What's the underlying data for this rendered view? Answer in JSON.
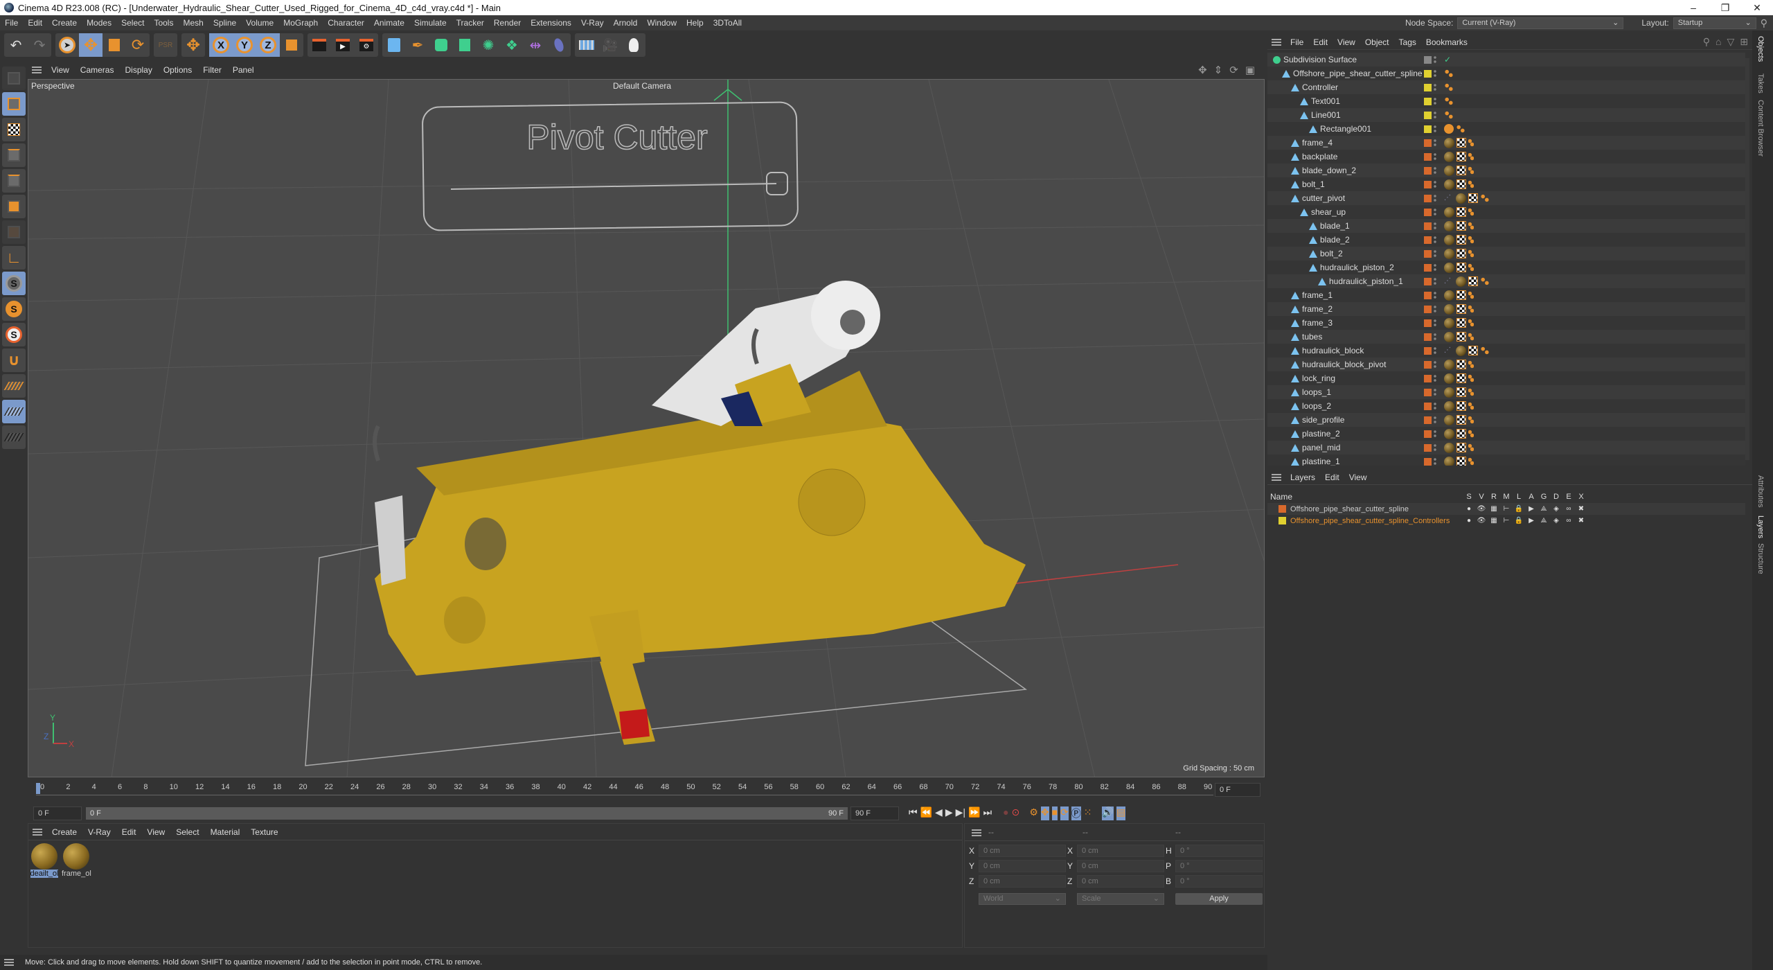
{
  "window": {
    "title": "Cinema 4D R23.008 (RC) - [Underwater_Hydraulic_Shear_Cutter_Used_Rigged_for_Cinema_4D_c4d_vray.c4d *] - Main",
    "controls": [
      "–",
      "❐",
      "✕"
    ]
  },
  "menubar": {
    "items": [
      "File",
      "Edit",
      "Create",
      "Modes",
      "Select",
      "Tools",
      "Mesh",
      "Spline",
      "Volume",
      "MoGraph",
      "Character",
      "Animate",
      "Simulate",
      "Tracker",
      "Render",
      "Extensions",
      "V-Ray",
      "Arnold",
      "Window",
      "Help",
      "3DToAll"
    ],
    "node_space_label": "Node Space:",
    "node_space_value": "Current (V-Ray)",
    "layout_label": "Layout:",
    "layout_value": "Startup"
  },
  "toolbar": {
    "axis_x": "X",
    "axis_y": "Y",
    "axis_z": "Z"
  },
  "viewport": {
    "menu": [
      "View",
      "Cameras",
      "Display",
      "Options",
      "Filter",
      "Panel"
    ],
    "view_name": "Perspective",
    "camera": "Default Camera",
    "grid_spacing": "Grid Spacing : 50 cm",
    "controller_text": "Pivot Cutter",
    "axis_labels": {
      "x": "X",
      "y": "Y",
      "z": "Z"
    }
  },
  "timeline": {
    "ticks": [
      "0",
      "2",
      "4",
      "6",
      "8",
      "10",
      "12",
      "14",
      "16",
      "18",
      "20",
      "22",
      "24",
      "26",
      "28",
      "30",
      "32",
      "34",
      "36",
      "38",
      "40",
      "42",
      "44",
      "46",
      "48",
      "50",
      "52",
      "54",
      "56",
      "58",
      "60",
      "62",
      "64",
      "66",
      "68",
      "70",
      "72",
      "74",
      "76",
      "78",
      "80",
      "82",
      "84",
      "86",
      "88",
      "90"
    ],
    "current_frame_field": "0 F",
    "start_field": "0 F",
    "range_start": "0 F",
    "range_end": "90 F",
    "end_field": "90 F",
    "current_right": "0 F"
  },
  "material_manager": {
    "menu": [
      "Create",
      "V-Ray",
      "Edit",
      "View",
      "Select",
      "Material",
      "Texture"
    ],
    "materials": [
      {
        "name": "deailt_ol",
        "selected": true
      },
      {
        "name": "frame_ol",
        "selected": false
      }
    ]
  },
  "coordinates": {
    "headers": [
      "--",
      "--",
      "--"
    ],
    "rows": [
      {
        "l1": "X",
        "v1": "0 cm",
        "l2": "X",
        "v2": "0 cm",
        "l3": "H",
        "v3": "0 °"
      },
      {
        "l1": "Y",
        "v1": "0 cm",
        "l2": "Y",
        "v2": "0 cm",
        "l3": "P",
        "v3": "0 °"
      },
      {
        "l1": "Z",
        "v1": "0 cm",
        "l2": "Z",
        "v2": "0 cm",
        "l3": "B",
        "v3": "0 °"
      }
    ],
    "mode": "World",
    "transform": "Scale",
    "apply": "Apply"
  },
  "status": "Move: Click and drag to move elements. Hold down SHIFT to quantize movement / add to the selection in point mode, CTRL to remove.",
  "object_manager": {
    "menu": [
      "File",
      "Edit",
      "View",
      "Object",
      "Tags",
      "Bookmarks"
    ],
    "objects": [
      {
        "name": "Subdivision Surface",
        "depth": 0,
        "color": "#888888",
        "tags": "check",
        "root": true
      },
      {
        "name": "Offshore_pipe_shear_cutter_spline",
        "depth": 1,
        "color": "#e0d030",
        "tags": "spline"
      },
      {
        "name": "Controller",
        "depth": 2,
        "color": "#e0d030",
        "tags": "spline"
      },
      {
        "name": "Text001",
        "depth": 3,
        "color": "#e0d030",
        "tags": "spline"
      },
      {
        "name": "Line001",
        "depth": 3,
        "color": "#e0d030",
        "tags": "spline"
      },
      {
        "name": "Rectangle001",
        "depth": 4,
        "color": "#e0d030",
        "tags": "nospline"
      },
      {
        "name": "frame_4",
        "depth": 2,
        "color": "#d8692c",
        "tags": "mat"
      },
      {
        "name": "backplate",
        "depth": 2,
        "color": "#d8692c",
        "tags": "mat"
      },
      {
        "name": "blade_down_2",
        "depth": 2,
        "color": "#d8692c",
        "tags": "mat"
      },
      {
        "name": "bolt_1",
        "depth": 2,
        "color": "#d8692c",
        "tags": "mat"
      },
      {
        "name": "cutter_pivot",
        "depth": 2,
        "color": "#d8692c",
        "tags": "ik"
      },
      {
        "name": "shear_up",
        "depth": 3,
        "color": "#d8692c",
        "tags": "mat"
      },
      {
        "name": "blade_1",
        "depth": 4,
        "color": "#d8692c",
        "tags": "mat"
      },
      {
        "name": "blade_2",
        "depth": 4,
        "color": "#d8692c",
        "tags": "mat"
      },
      {
        "name": "bolt_2",
        "depth": 4,
        "color": "#d8692c",
        "tags": "mat"
      },
      {
        "name": "hudraulick_piston_2",
        "depth": 4,
        "color": "#d8692c",
        "tags": "mat"
      },
      {
        "name": "hudraulick_piston_1",
        "depth": 5,
        "color": "#d8692c",
        "tags": "ik"
      },
      {
        "name": "frame_1",
        "depth": 2,
        "color": "#d8692c",
        "tags": "mat"
      },
      {
        "name": "frame_2",
        "depth": 2,
        "color": "#d8692c",
        "tags": "mat"
      },
      {
        "name": "frame_3",
        "depth": 2,
        "color": "#d8692c",
        "tags": "mat"
      },
      {
        "name": "tubes",
        "depth": 2,
        "color": "#d8692c",
        "tags": "mat"
      },
      {
        "name": "hudraulick_block",
        "depth": 2,
        "color": "#d8692c",
        "tags": "ik"
      },
      {
        "name": "hudraulick_block_pivot",
        "depth": 2,
        "color": "#d8692c",
        "tags": "mat"
      },
      {
        "name": "lock_ring",
        "depth": 2,
        "color": "#d8692c",
        "tags": "mat"
      },
      {
        "name": "loops_1",
        "depth": 2,
        "color": "#d8692c",
        "tags": "mat"
      },
      {
        "name": "loops_2",
        "depth": 2,
        "color": "#d8692c",
        "tags": "mat"
      },
      {
        "name": "side_profile",
        "depth": 2,
        "color": "#d8692c",
        "tags": "mat"
      },
      {
        "name": "plastine_2",
        "depth": 2,
        "color": "#d8692c",
        "tags": "mat"
      },
      {
        "name": "panel_mid",
        "depth": 2,
        "color": "#d8692c",
        "tags": "mat"
      },
      {
        "name": "plastine_1",
        "depth": 2,
        "color": "#d8692c",
        "tags": "mat"
      }
    ]
  },
  "layer_manager": {
    "menu": [
      "Layers",
      "Edit",
      "View"
    ],
    "name_header": "Name",
    "columns": [
      "S",
      "V",
      "R",
      "M",
      "L",
      "A",
      "G",
      "D",
      "E",
      "X"
    ],
    "layers": [
      {
        "name": "Offshore_pipe_shear_cutter_spline",
        "color": "#d8692c",
        "highlight": false
      },
      {
        "name": "Offshore_pipe_shear_cutter_spline_Controllers",
        "color": "#e0d030",
        "highlight": true
      }
    ]
  },
  "side_tabs": {
    "top": [
      "Objects",
      "Takes",
      "Content Browser"
    ],
    "bottom": [
      "Attributes",
      "Layers",
      "Structure"
    ]
  }
}
